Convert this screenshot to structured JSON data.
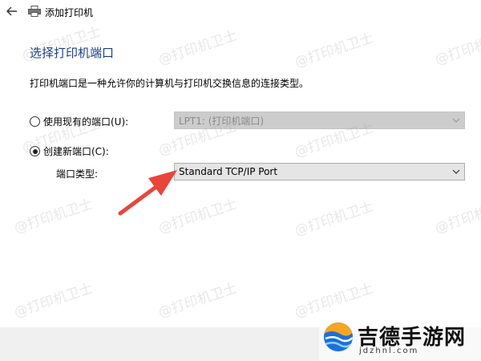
{
  "window": {
    "title": "添加打印机"
  },
  "page": {
    "heading": "选择打印机端口",
    "description": "打印机端口是一种允许你的计算机与打印机交换信息的连接类型。"
  },
  "options": {
    "existing": {
      "label": "使用现有的端口(U):",
      "selected": false,
      "value": "LPT1: (打印机端口)"
    },
    "new": {
      "label": "创建新端口(C):",
      "selected": true
    },
    "port_type_label": "端口类型:",
    "port_type_value": "Standard TCP/IP Port"
  },
  "watermark": {
    "text": "@打印机卫士"
  },
  "logo": {
    "name": "吉德手游网",
    "domain": "jdzhnl.com"
  },
  "colors": {
    "heading": "#1a3e8c",
    "arrow": "#e8453c"
  }
}
